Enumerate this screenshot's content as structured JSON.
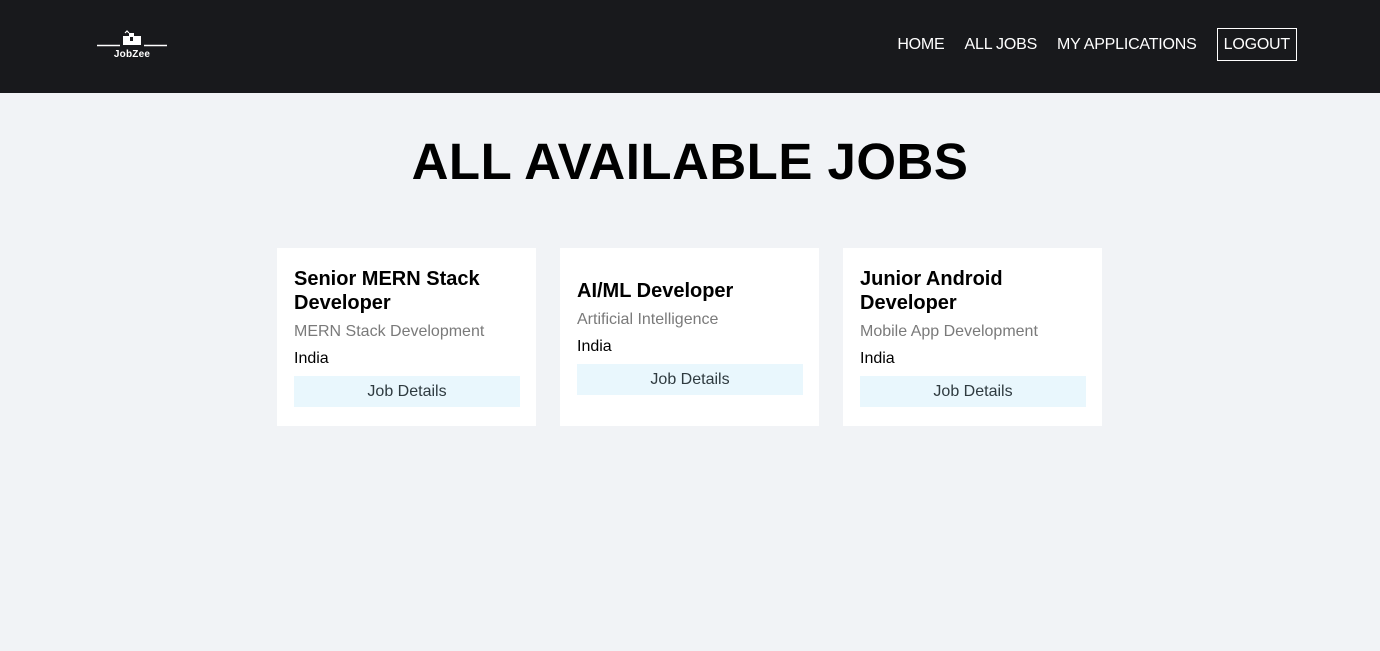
{
  "brand": {
    "name": "JobZee",
    "icon": "briefcase-icon"
  },
  "nav": {
    "items": [
      {
        "label": "HOME"
      },
      {
        "label": "ALL JOBS"
      },
      {
        "label": "MY APPLICATIONS"
      }
    ],
    "logout_label": "LOGOUT"
  },
  "colors": {
    "navbar_bg": "#18191c",
    "page_bg": "#f1f3f6",
    "button_bg": "#e9f7fd"
  },
  "main": {
    "title": "ALL AVAILABLE JOBS",
    "jobs": [
      {
        "title": "Senior MERN Stack Developer",
        "category": "MERN Stack Development",
        "country": "India",
        "button_label": "Job Details"
      },
      {
        "title": "AI/ML Developer",
        "category": "Artificial Intelligence",
        "country": "India",
        "button_label": "Job Details"
      },
      {
        "title": "Junior Android Developer",
        "category": "Mobile App Development",
        "country": "India",
        "button_label": "Job Details"
      }
    ]
  }
}
